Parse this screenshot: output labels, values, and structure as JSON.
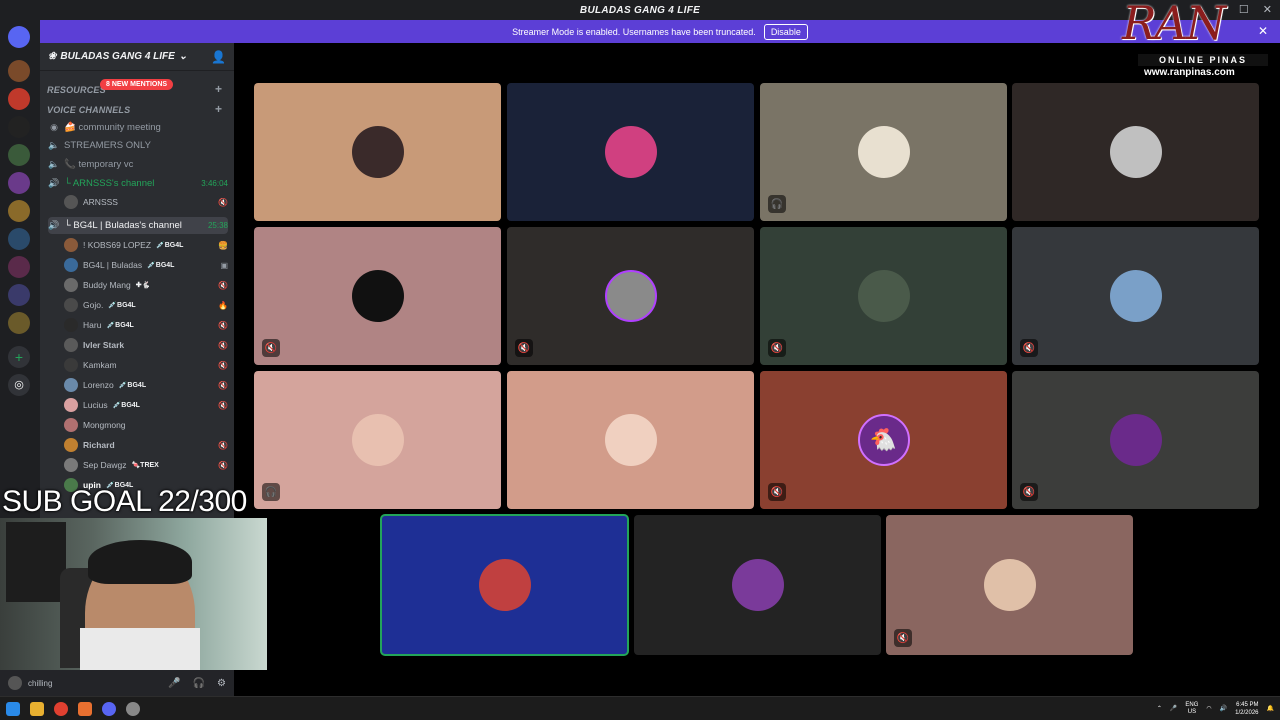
{
  "window": {
    "title": "BULADAS GANG 4 LIFE"
  },
  "banner": {
    "text": "Streamer Mode is enabled. Usernames have been truncated.",
    "button": "Disable"
  },
  "server": {
    "name": "BULADAS GANG 4 LIFE"
  },
  "sidebar": {
    "cat_resources": "RESOURCES",
    "mentions": "8 NEW MENTIONS",
    "cat_voice": "VOICE CHANNELS",
    "channels": [
      {
        "label": "🍰 community meeting"
      },
      {
        "label": "STREAMERS ONLY"
      },
      {
        "label": "📞 temporary vc"
      },
      {
        "label": "└ ARNSSS's channel",
        "time": "3:46:04"
      },
      {
        "label": "└ BG4L | Buladas's channel",
        "time": "25:38"
      }
    ],
    "arnsss_user": "ARNSSS",
    "users": [
      {
        "name": "! KOBS69 LOPEZ",
        "tag": "💉BG4L"
      },
      {
        "name": "BG4L | Buladas",
        "tag": "💉BG4L"
      },
      {
        "name": "Buddy Mang",
        "tag": "✚🐇"
      },
      {
        "name": "Gojo.",
        "tag": "💉BG4L"
      },
      {
        "name": "Haru",
        "tag": "💉BG4L"
      },
      {
        "name": "Ivler Stark",
        "tag": ""
      },
      {
        "name": "Kamkam",
        "tag": ""
      },
      {
        "name": "Lorenzo",
        "tag": "💉BG4L"
      },
      {
        "name": "Lucius",
        "tag": "💉BG4L"
      },
      {
        "name": "Mongmong",
        "tag": ""
      },
      {
        "name": "Richard",
        "tag": ""
      },
      {
        "name": "Sep Dawgz",
        "tag": "🍬TREX"
      },
      {
        "name": "upin",
        "tag": "💉BG4L"
      }
    ]
  },
  "overlay": {
    "subgoal": "SUB GOAL 22/300",
    "ran_logo": "RAN",
    "ran_sub": "ONLINE PINAS",
    "ran_url": "www.ranpinas.com"
  },
  "userbar": {
    "status": "chilling"
  },
  "tray": {
    "lang1": "ENG",
    "lang2": "US",
    "time": "6:45 PM",
    "date": "1/2/2026"
  },
  "colors": {
    "accent": "#5c3fd6",
    "speaking": "#23a55a"
  }
}
